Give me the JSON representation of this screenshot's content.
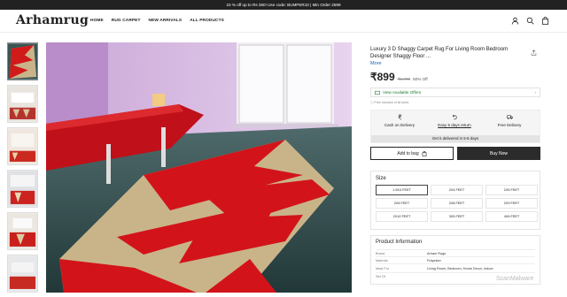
{
  "promo": "10 % off up to Rs 350! Use code: BUMPER10 | Min Order 2599",
  "brand": "Arhamrug",
  "nav": [
    "HOME",
    "RUG CARPET",
    "NEW ARRIVALS",
    "ALL PRODUCTS"
  ],
  "header_icons": [
    "user-icon",
    "search-icon",
    "bag-icon"
  ],
  "product": {
    "title": "Luxury 3 D Shaggy Carpet Rug For Living Room Bedroom Designer Shaggy Floor ...",
    "more": "More",
    "price": "₹899",
    "mrp": "₹1,799",
    "discount": "50% Off",
    "offers_label": "View Available Offers",
    "tax_note": "Price inclusive of all taxes",
    "services": [
      {
        "label": "Cash on Delivery",
        "icon": "rupee-icon"
      },
      {
        "label": "Easy 5 days return",
        "icon": "return-icon"
      },
      {
        "label": "Free Delivery",
        "icon": "truck-icon"
      }
    ],
    "delivery": "Get it delivered in 5-6 days",
    "add_to_bag": "Add to bag",
    "buy_now": "Buy Now"
  },
  "size": {
    "heading": "Size",
    "options": [
      "1.5X4 FEET",
      "2X4 FEET",
      "2X5 FEET",
      "2X6 FEET",
      "2X8 FEET",
      "2X9 FEET",
      "2X10 FEET",
      "3X5 FEET",
      "4X6 FEET"
    ],
    "selected": "1.5X4 FEET"
  },
  "product_info": {
    "heading": "Product Information",
    "rows": [
      {
        "key": "Brand",
        "value": "Arham Rugs"
      },
      {
        "key": "Material",
        "value": "Polyester"
      },
      {
        "key": "Ideal For",
        "value": "Living Room, Bedroom, Home Decor, Indoor"
      },
      {
        "key": "Set Of",
        "value": ""
      }
    ]
  },
  "watermark": "ScanMalware",
  "colors": {
    "rug_red": "#d11a1a",
    "rug_beige": "#c9b48a",
    "floor": "#2f4a4a",
    "wall": "#c8a8d6"
  }
}
